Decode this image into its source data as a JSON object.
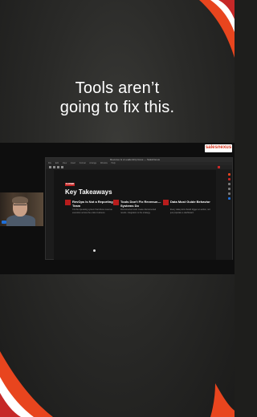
{
  "headline": {
    "line1": "Tools aren’t",
    "line2": "going to fix this."
  },
  "brand": {
    "name": "salesnexus",
    "tagline": ""
  },
  "window": {
    "title": "Revenue Is a Leadership Issue — SalesNexus",
    "menu": [
      "File",
      "Edit",
      "View",
      "Insert",
      "Format",
      "Arrange",
      "Window",
      "Help"
    ]
  },
  "slide": {
    "tag": "CLOSER",
    "title": "Key Takeaways",
    "items": [
      {
        "title": "RevOps Is Not a Reporting Team",
        "body": "It is the operating system that drives revenue execution across the entire business."
      },
      {
        "title": "Tools Don't Fix Revenue— Systems Do",
        "body": "Disconnected tools create disconnected results. Integration is the strategy."
      },
      {
        "title": "Data Must Guide Behavior",
        "body": "Every data point should trigger an action, not just populate a dashboard."
      }
    ]
  },
  "colors": {
    "accent": "#e8451e",
    "accent_dark": "#c62828",
    "background": "#2a2a28"
  }
}
